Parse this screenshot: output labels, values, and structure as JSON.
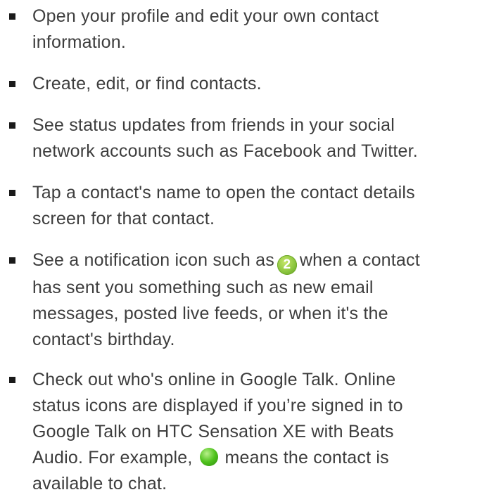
{
  "items": [
    {
      "lines": [
        "Open your profile and edit your own contact",
        "information."
      ]
    },
    {
      "lines": [
        "Create, edit, or find contacts."
      ]
    },
    {
      "lines": [
        "See status updates from friends in your social",
        "network accounts such as Facebook and Twitter."
      ]
    },
    {
      "lines": [
        "Tap a contact's name to open the contact details",
        "screen for that contact."
      ]
    },
    {
      "line1_before": "See a notification icon such as",
      "badge_value": "2",
      "line1_after": "when a contact",
      "rest_lines": [
        "has sent you something such as new email",
        "messages, posted live feeds, or when it's the",
        "contact's birthday."
      ]
    },
    {
      "lines_before": [
        "Check out who's online in Google Talk. Online",
        "status icons are displayed if you’re signed in to",
        "Google Talk on HTC Sensation XE with Beats"
      ],
      "line4_before": "Audio. For example,",
      "line4_after": "means the contact is",
      "last_line": "available to chat."
    }
  ],
  "icons": {
    "notification_badge": "notification-count-badge-icon",
    "online_status": "online-status-green-dot-icon"
  },
  "colors": {
    "text": "#3d3d3d",
    "badge": "#8cc63f",
    "online": "#4fc21d"
  }
}
